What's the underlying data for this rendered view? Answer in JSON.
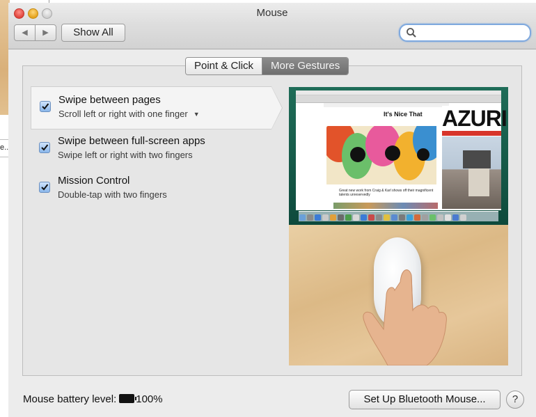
{
  "background": {
    "left_tab_text": "e..."
  },
  "window": {
    "title": "Mouse"
  },
  "toolbar": {
    "back_glyph": "◀",
    "forward_glyph": "▶",
    "show_all_label": "Show All",
    "search_placeholder": ""
  },
  "tabs": [
    {
      "label": "Point & Click",
      "selected": false
    },
    {
      "label": "More Gestures",
      "selected": true
    }
  ],
  "gestures": [
    {
      "title": "Swipe between pages",
      "subtitle": "Scroll left or right with one finger",
      "checked": true,
      "has_dropdown": true,
      "selected": true
    },
    {
      "title": "Swipe between full-screen apps",
      "subtitle": "Swipe left or right with two fingers",
      "checked": true
    },
    {
      "title": "Mission Control",
      "subtitle": "Double-tap with two fingers",
      "checked": true
    }
  ],
  "preview": {
    "site_title": "It's Nice That",
    "headline_right": "AZURI",
    "caption": "Great new work from Craig & Karl shows off their magnificent talents unreservedly"
  },
  "footer": {
    "battery_label": "Mouse battery level:",
    "battery_value": "100%",
    "bluetooth_button": "Set Up Bluetooth Mouse...",
    "help_label": "?"
  },
  "colors": {
    "accent": "#7fa9de",
    "selected_tab": "#7a7a7a",
    "close": "#e0443b",
    "minimize": "#e5a31e"
  }
}
